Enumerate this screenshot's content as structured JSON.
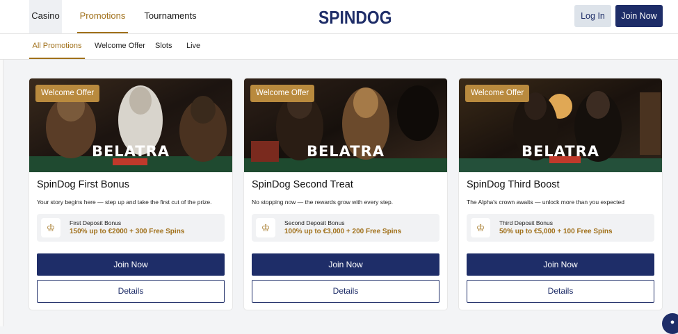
{
  "header": {
    "nav": [
      "Casino",
      "Promotions",
      "Tournaments"
    ],
    "logo": "SPINDOG",
    "login_label": "Log In",
    "join_label": "Join Now"
  },
  "subnav": [
    "All Promotions",
    "Welcome Offer",
    "Slots",
    "Live"
  ],
  "cards": [
    {
      "badge": "Welcome Offer",
      "brand": "BELATRA",
      "title": "SpinDog First Bonus",
      "desc": "Your story begins here — step up and take the first cut of the prize.",
      "bonus_label": "First Deposit Bonus",
      "bonus_value": "150% up to €2000 + 300 Free Spins",
      "join_label": "Join Now",
      "details_label": "Details"
    },
    {
      "badge": "Welcome Offer",
      "brand": "BELATRA",
      "title": "SpinDog Second Treat",
      "desc": "No stopping now — the rewards grow with every step.",
      "bonus_label": "Second Deposit Bonus",
      "bonus_value": "100% up to €3,000 + 200 Free Spins",
      "join_label": "Join Now",
      "details_label": "Details"
    },
    {
      "badge": "Welcome Offer",
      "brand": "BELATRA",
      "title": "SpinDog Third Boost",
      "desc": "The Alpha's crown awaits — unlock more than you expected",
      "bonus_label": "Third Deposit Bonus",
      "bonus_value": "50% up to €5,000 + 100 Free Spins",
      "join_label": "Join Now",
      "details_label": "Details"
    }
  ],
  "icons": {
    "bonus": "crown-icon",
    "chat": "chat-icon"
  },
  "colors": {
    "brand_navy": "#1e2d68",
    "accent_gold": "#a0701a",
    "badge_gold": "#b98a3e"
  }
}
